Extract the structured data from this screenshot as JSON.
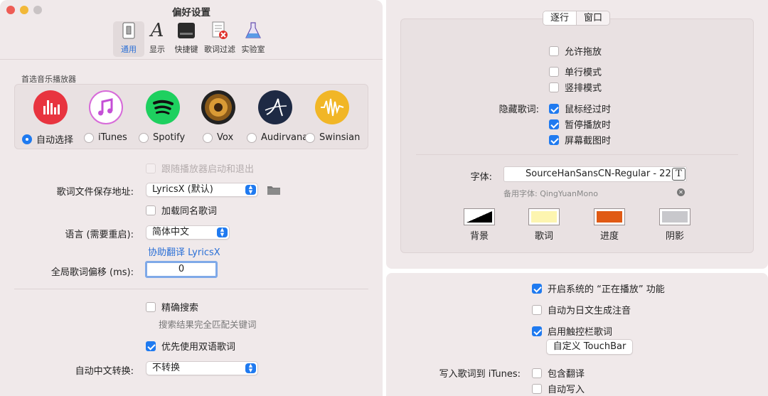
{
  "colors": {
    "accent": "#1f7af0",
    "link": "#2a6fd6",
    "panel": "#f0e9ea"
  },
  "window": {
    "title": "偏好设置"
  },
  "toolbar": {
    "items": [
      {
        "label": "通用",
        "icon": "general-icon"
      },
      {
        "label": "显示",
        "icon": "font-a-icon"
      },
      {
        "label": "快捷键",
        "icon": "command-icon"
      },
      {
        "label": "歌词过滤",
        "icon": "filter-doc-icon"
      },
      {
        "label": "实验室",
        "icon": "flask-icon"
      }
    ],
    "active": "通用"
  },
  "general": {
    "player_section_title": "首选音乐播放器",
    "players": [
      {
        "label": "自动选择",
        "icon": "auto-select-icon",
        "selected": true
      },
      {
        "label": "iTunes",
        "icon": "itunes-icon",
        "selected": false
      },
      {
        "label": "Spotify",
        "icon": "spotify-icon",
        "selected": false
      },
      {
        "label": "Vox",
        "icon": "vox-icon",
        "selected": false
      },
      {
        "label": "Audirvana",
        "icon": "audirvana-icon",
        "selected": false
      },
      {
        "label": "Swinsian",
        "icon": "swinsian-icon",
        "selected": false
      }
    ],
    "follow_player_label": "跟随播放器启动和退出",
    "lyrics_path_label": "歌词文件保存地址:",
    "lyrics_path_value": "LyricsX (默认)",
    "load_same_name_label": "加载同名歌词",
    "language_label": "语言 (需要重启):",
    "language_value": "简体中文",
    "help_translate_link": "协助翻译 LyricsX",
    "offset_label": "全局歌词偏移 (ms):",
    "offset_value": "0",
    "precise_search_label": "精确搜索",
    "precise_search_hint": "搜索结果完全匹配关键词",
    "prefer_bilingual_label": "优先使用双语歌词",
    "chinese_convert_label": "自动中文转换:",
    "chinese_convert_value": "不转换"
  },
  "display": {
    "tabs": [
      "逐行",
      "窗口"
    ],
    "allow_drag_label": "允许拖放",
    "single_line_label": "单行模式",
    "vertical_label": "竖排模式",
    "hide_lyrics_label": "隐藏歌词:",
    "hide_options": [
      {
        "label": "鼠标经过时",
        "checked": true
      },
      {
        "label": "暂停播放时",
        "checked": true
      },
      {
        "label": "屏幕截图时",
        "checked": true
      }
    ],
    "font_label": "字体:",
    "font_value": "SourceHanSansCN-Regular - 22",
    "font_button_glyph": "T",
    "fallback_font": "备用字体: QingYuanMono",
    "swatches": [
      {
        "label": "背景",
        "color": "#000000"
      },
      {
        "label": "歌词",
        "color": "#fdf5b0"
      },
      {
        "label": "进度",
        "color": "#e05a14"
      },
      {
        "label": "阴影",
        "color": "#c8c8cc"
      }
    ]
  },
  "lab": {
    "now_playing_label": "开启系统的 “正在播放” 功能",
    "furigana_label": "自动为日文生成注音",
    "touchbar_lyrics_label": "启用触控栏歌词",
    "customize_touchbar_button": "自定义 TouchBar",
    "write_itunes_label": "写入歌词到 iTunes:",
    "include_translation_label": "包含翻译",
    "auto_write_label": "自动写入"
  }
}
